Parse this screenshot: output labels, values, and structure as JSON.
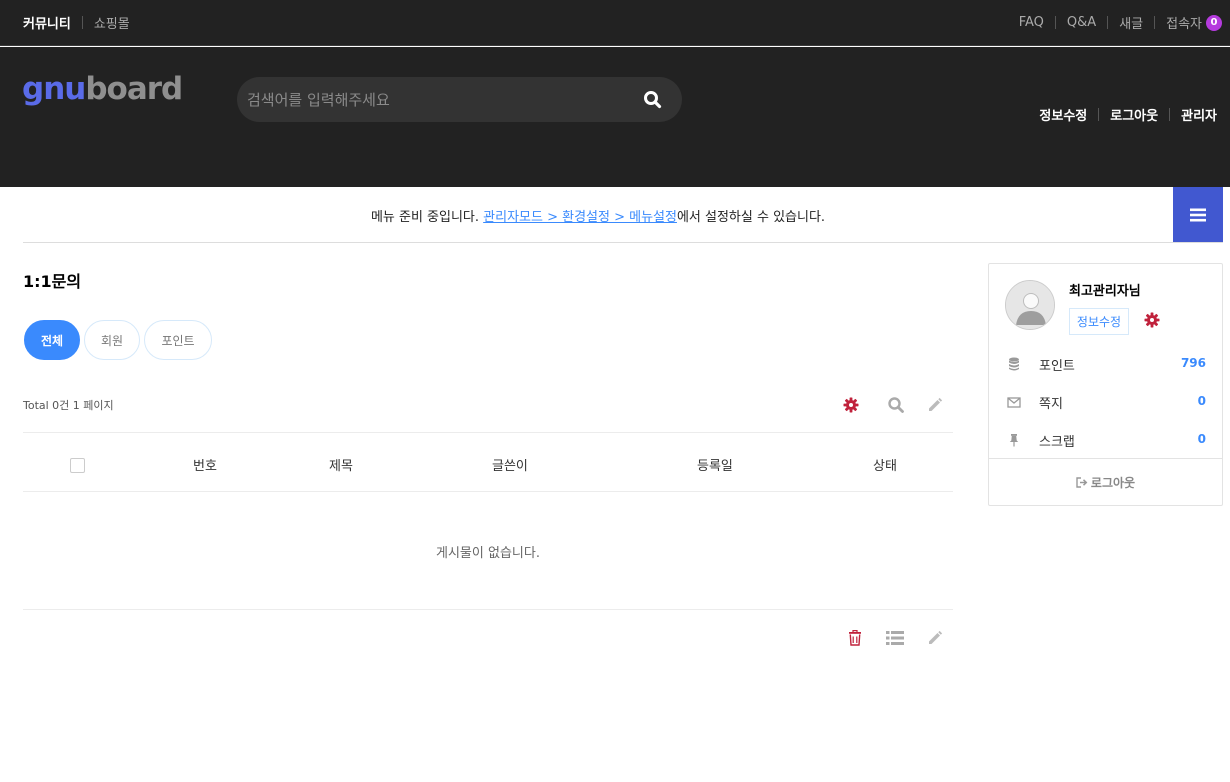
{
  "topbar": {
    "left": [
      {
        "label": "커뮤니티",
        "active": true
      },
      {
        "label": "쇼핑몰",
        "active": false
      }
    ],
    "right": {
      "faq": "FAQ",
      "qa": "Q&A",
      "new": "새글",
      "visitors": "접속자",
      "visitors_count": "0"
    }
  },
  "header": {
    "logo_part1": "gnu",
    "logo_part2": "board",
    "search_placeholder": "검색어를 입력해주세요",
    "links": {
      "edit_info": "정보수정",
      "logout": "로그아웃",
      "admin": "관리자"
    }
  },
  "gnb": {
    "msg_before": "메뉴 준비 중입니다. ",
    "msg_link": "관리자모드 > 환경설정 > 메뉴설정",
    "msg_after": "에서 설정하실 수 있습니다."
  },
  "board": {
    "title": "1:1문의",
    "tabs": [
      "전체",
      "회원",
      "포인트"
    ],
    "total_info": "Total 0건 1 페이지",
    "columns": {
      "number": "번호",
      "subject": "제목",
      "writer": "글쓴이",
      "date": "등록일",
      "status": "상태"
    },
    "empty_message": "게시물이 없습니다."
  },
  "sidebar": {
    "user_name": "최고관리자님",
    "edit_button": "정보수정",
    "rows": [
      {
        "label": "포인트",
        "value": "796",
        "icon": "database-icon"
      },
      {
        "label": "쪽지",
        "value": "0",
        "icon": "envelope-icon"
      },
      {
        "label": "스크랩",
        "value": "0",
        "icon": "pin-icon"
      }
    ],
    "logout": "로그아웃"
  },
  "colors": {
    "header_bg": "#222222",
    "accent_blue": "#3a8afd",
    "menu_button": "#4158d0",
    "badge_purple": "#b53bde",
    "gear_red": "#c0223c"
  }
}
